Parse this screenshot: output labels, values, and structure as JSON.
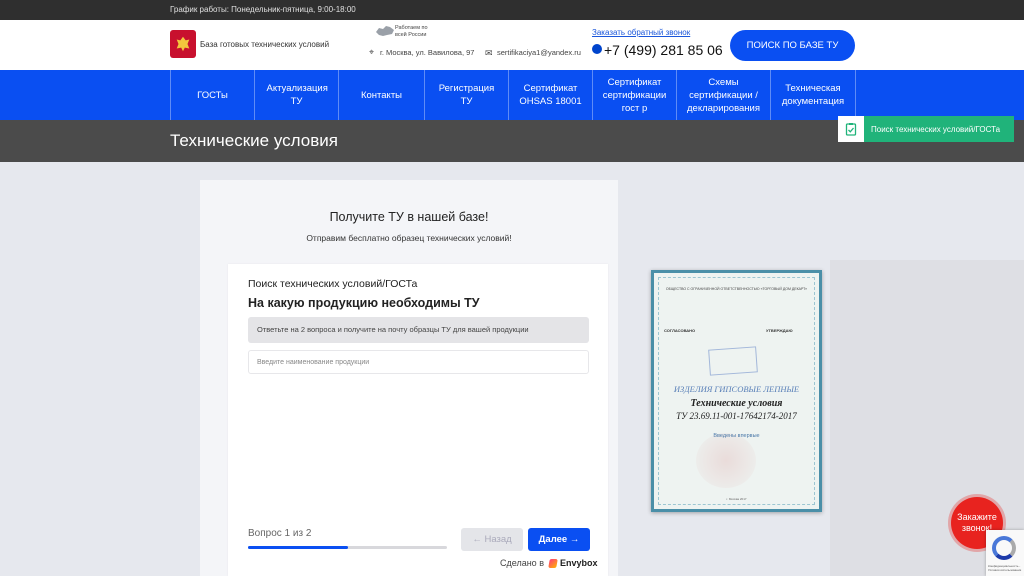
{
  "topbar": {
    "schedule": "График работы: Понедельник-пятница, 9:00-18:00"
  },
  "header": {
    "site_name": "База готовых технических условий",
    "work_region": "Работаем по всей России",
    "address": "г. Москва, ул. Вавилова, 97",
    "email": "sertifikaciya1@yandex.ru",
    "callback_link": "Заказать обратный звонок",
    "phone": "+7 (499) 281 85 06",
    "search_button": "ПОИСК ПО БАЗЕ ТУ",
    "icons": [
      "emblem-icon",
      "russia-map-icon",
      "location-pin-icon",
      "mail-icon",
      "phone-icon"
    ]
  },
  "nav": {
    "items": [
      {
        "label": "ГОСТы"
      },
      {
        "label": "Актуализация ТУ"
      },
      {
        "label": "Контакты"
      },
      {
        "label": "Регистрация ТУ"
      },
      {
        "label": "Сертификат OHSAS 18001"
      },
      {
        "label": "Сертификат сертификации гост р"
      },
      {
        "label": "Схемы сертификации /декларирования"
      },
      {
        "label": "Техническая документация"
      }
    ]
  },
  "page": {
    "title": "Технические условия",
    "side_tab": "Поиск технических условий/ГОСТа"
  },
  "form": {
    "heading": "Получите ТУ в нашей базе!",
    "subheading": "Отправим бесплатно образец технических условий!",
    "section_title": "Поиск технических условий/ГОСТа",
    "question": "На какую продукцию необходимы ТУ",
    "hint": "Ответьте на 2 вопроса и получите на почту образцы ТУ для вашей продукции",
    "input_value": "",
    "input_placeholder": "Введите наименование продукции",
    "progress_label": "Вопрос 1 из 2",
    "progress_fraction": 0.5,
    "back_button": "← Назад",
    "next_button": "Далее →",
    "made_in_prefix": "Сделано в",
    "made_in_brand": "Envybox"
  },
  "document": {
    "org": "ОБЩЕСТВО С ОГРАНИЧЕННОЙ ОТВЕТСТВЕННОСТЬЮ «ТОРГОВЫЙ ДОМ ДЕКАРТ»",
    "approved_left": "СОГЛАСОВАНО",
    "approved_right": "УТВЕРЖДАЮ",
    "product": "ИЗДЕЛИЯ ГИПСОВЫЕ ЛЕПНЫЕ",
    "title": "Технические условия",
    "code": "ТУ 23.69.11-001-17642174-2017",
    "first_issue": "Введены впервые",
    "city": "г. Москва 2017"
  },
  "widgets": {
    "call_bubble": "Закажите звонок!",
    "recaptcha_text": "Конфиденциальность - Условия использования"
  },
  "colors": {
    "primary_blue": "#0a4ff2",
    "topbar": "#2f2f2f",
    "title_band": "#4b4b4b",
    "side_tab_green": "#20b37a",
    "call_red": "#e8231f"
  }
}
